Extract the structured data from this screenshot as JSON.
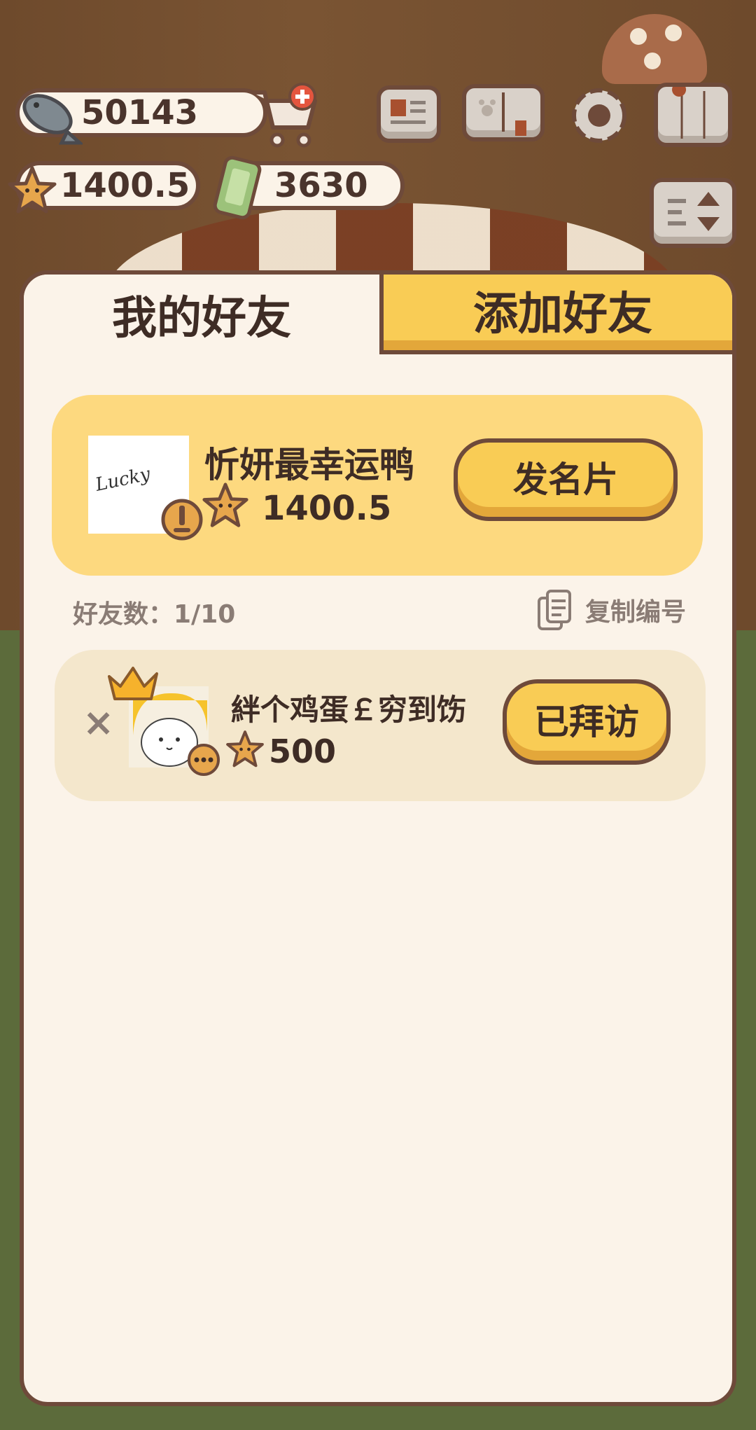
{
  "hud": {
    "fish_count": "50143",
    "star_count": "1400.5",
    "ticket_count": "3630"
  },
  "tabs": {
    "my_friends": "我的好友",
    "add_friend": "添加好友"
  },
  "me": {
    "name": "忻妍最幸运鸭",
    "score": "1400.5",
    "send_card_label": "发名片",
    "avatar_text": "Lucky"
  },
  "friends_count_label": "好友数：1/10",
  "copy_id_label": "复制编号",
  "friends": [
    {
      "name": "絆个鸡蛋￡穷到饬",
      "score": "500",
      "status_label": "已拜访",
      "remove_symbol": "×"
    }
  ],
  "colors": {
    "accent_yellow": "#f9cc55",
    "outline_brown": "#6e4a3a",
    "panel_bg": "#fbf3e9",
    "star_orange": "#e7a64c"
  }
}
